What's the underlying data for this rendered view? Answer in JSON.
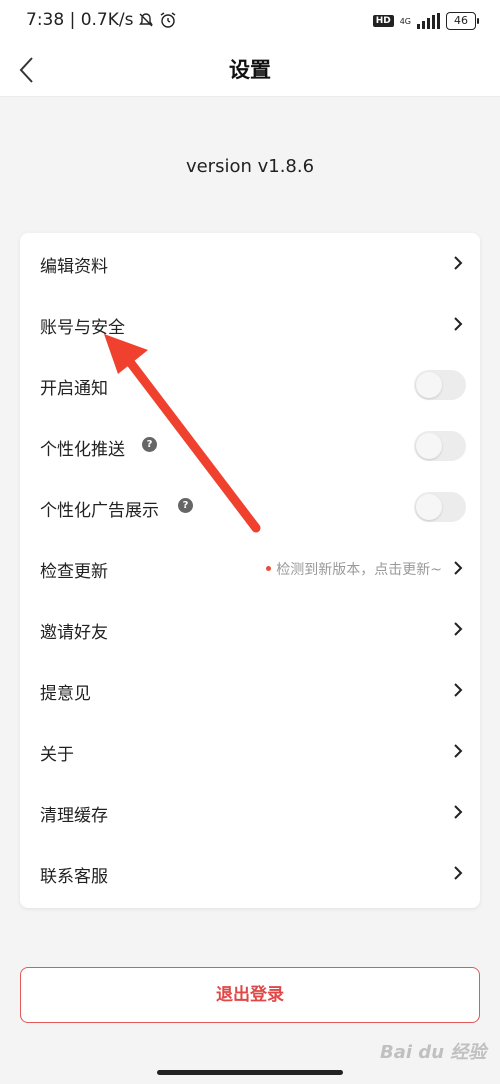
{
  "status_bar": {
    "time_speed": "7:38 | 0.7K/s",
    "hd_badge": "HD",
    "network": "4G",
    "battery": "46"
  },
  "nav": {
    "title": "设置"
  },
  "version_text": "version v1.8.6",
  "settings": {
    "edit_profile": "编辑资料",
    "account_security": "账号与安全",
    "enable_notifications": "开启通知",
    "personalized_push": "个性化推送",
    "personalized_ads": "个性化广告展示",
    "check_update": "检查更新",
    "update_hint": "检测到新版本，点击更新~",
    "invite_friends": "邀请好友",
    "feedback": "提意见",
    "about": "关于",
    "clear_cache": "清理缓存",
    "contact_service": "联系客服",
    "help_mark": "?"
  },
  "toggles": {
    "enable_notifications": false,
    "personalized_push": false,
    "personalized_ads": false
  },
  "logout_label": "退出登录",
  "watermark_text": "Bai du 经验",
  "colors": {
    "accent_red": "#e04848",
    "arrow_red": "#f0402e",
    "update_dot": "#e74c3c"
  }
}
